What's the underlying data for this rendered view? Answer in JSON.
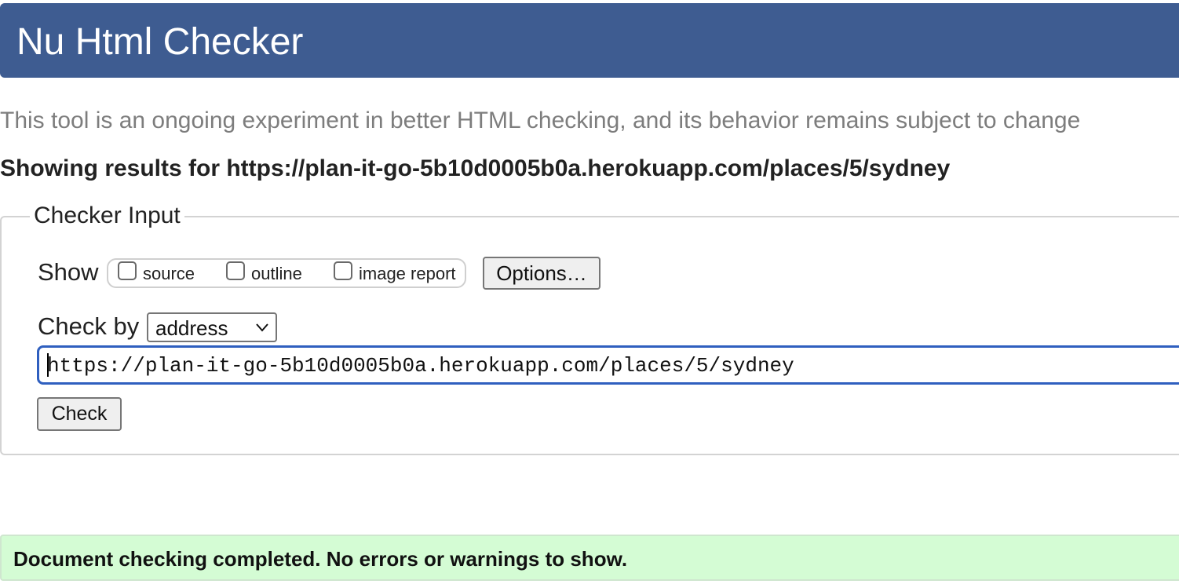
{
  "header": {
    "title": "Nu Html Checker"
  },
  "tagline": "This tool is an ongoing experiment in better HTML checking, and its behavior remains subject to change",
  "results_heading": "Showing results for https://plan-it-go-5b10d0005b0a.herokuapp.com/places/5/sydney",
  "checker_input": {
    "legend": "Checker Input",
    "show_label": "Show",
    "checkboxes": [
      {
        "label": "source",
        "checked": false
      },
      {
        "label": "outline",
        "checked": false
      },
      {
        "label": "image report",
        "checked": false
      }
    ],
    "options_label": "Options…",
    "check_by_label": "Check by",
    "check_by_selected": "address",
    "url_value": "https://plan-it-go-5b10d0005b0a.herokuapp.com/places/5/sydney",
    "check_label": "Check"
  },
  "status": {
    "message": "Document checking completed. No errors or warnings to show.",
    "color": "#d4fcd4"
  },
  "colors": {
    "header_bg": "#3e5c91",
    "input_focus": "#2f5fbf"
  },
  "icons": {
    "select_arrow": "chevron-down-icon"
  }
}
